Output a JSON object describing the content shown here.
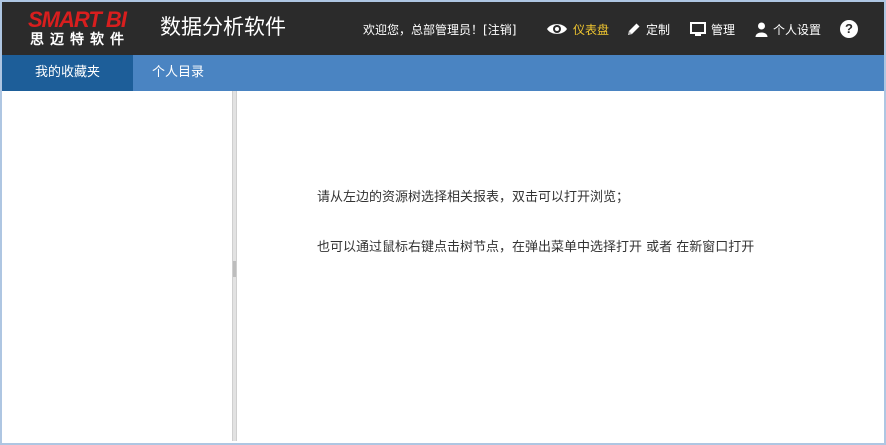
{
  "header": {
    "logo_word": "SMART BI",
    "logo_cn": "思迈特软件",
    "app_title": "数据分析软件",
    "welcome_text": "欢迎您，总部管理员！[",
    "logout_label": "注销",
    "welcome_close": "]",
    "nav": [
      {
        "label": "仪表盘",
        "icon": "eye-icon",
        "active": true
      },
      {
        "label": "定制",
        "icon": "pencil-icon",
        "active": false
      },
      {
        "label": "管理",
        "icon": "monitor-icon",
        "active": false
      },
      {
        "label": "个人设置",
        "icon": "user-icon",
        "active": false
      }
    ],
    "help_label": "?"
  },
  "tabs": [
    {
      "label": "我的收藏夹",
      "active": true
    },
    {
      "label": "个人目录",
      "active": false
    }
  ],
  "main": {
    "hint_line_1": "请从左边的资源树选择相关报表，双击可以打开浏览；",
    "hint_line_2": "也可以通过鼠标右键点击树节点，在弹出菜单中选择打开 或者 在新窗口打开"
  },
  "colors": {
    "header_bg": "#2b2b2b",
    "logo_red": "#d81e1e",
    "active_nav": "#f0c630",
    "tabbar_bg": "#4a84c2",
    "active_tab_bg": "#1d5e99",
    "frame_border": "#aec6e2"
  }
}
